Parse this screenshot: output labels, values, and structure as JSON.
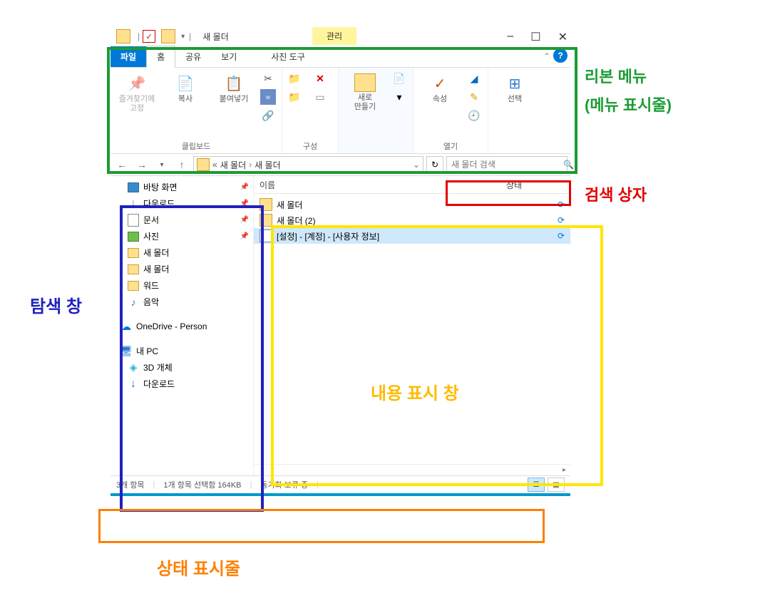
{
  "titlebar": {
    "title": "새 몰더",
    "contextual_tab": "관리"
  },
  "window_buttons": {
    "min": "–",
    "max": "☐",
    "close": "✕"
  },
  "tabs": {
    "file": "파일",
    "home": "홈",
    "share": "공유",
    "view": "보기",
    "tools": "사진 도구"
  },
  "ribbon": {
    "group1": {
      "pin": "즐겨찾기에\n고정",
      "copy": "복사",
      "paste": "붙여넣기",
      "label": "클립보드"
    },
    "group2": {
      "label": "구성"
    },
    "group3": {
      "new": "새로\n만들기",
      "label": ""
    },
    "group4": {
      "props": "속성",
      "label": "열기"
    },
    "group5": {
      "select": "선택"
    }
  },
  "nav_buttons": {
    "back": "←",
    "fwd": "→",
    "recent": "▾",
    "up": "↑"
  },
  "address": {
    "chevron": "«",
    "part1": "새 몰더",
    "part2": "새 몰더",
    "sep": "›"
  },
  "search": {
    "placeholder": "새 몰더 검색"
  },
  "columns": {
    "name": "이름",
    "status": "상태"
  },
  "navpane": [
    {
      "icon": "desktop",
      "label": "바탕 화면",
      "pinned": true
    },
    {
      "icon": "download",
      "label": "다운로드",
      "pinned": true
    },
    {
      "icon": "doc",
      "label": "문서",
      "pinned": true
    },
    {
      "icon": "pic",
      "label": "사진",
      "pinned": true
    },
    {
      "icon": "folder",
      "label": "새 몰더",
      "pinned": false
    },
    {
      "icon": "folder",
      "label": "새 몰더",
      "pinned": false
    },
    {
      "icon": "folder",
      "label": "워드",
      "pinned": false
    },
    {
      "icon": "music",
      "label": "음악",
      "pinned": false
    },
    {
      "icon": "cloud",
      "label": "OneDrive - Person",
      "pinned": false
    },
    {
      "icon": "pc",
      "label": "내 PC",
      "pinned": false
    },
    {
      "icon": "3d",
      "label": "3D 개체",
      "pinned": false
    },
    {
      "icon": "download",
      "label": "다운로드",
      "pinned": false
    }
  ],
  "rows": [
    {
      "type": "folder",
      "name": "새 몰더",
      "sync": true,
      "selected": false
    },
    {
      "type": "folder",
      "name": "새 몰더 (2)",
      "sync": true,
      "selected": false
    },
    {
      "type": "file",
      "name": "[설정] - [계정] - [사용자 정보]",
      "sync": true,
      "selected": true
    }
  ],
  "status": {
    "count": "3개 항목",
    "selected": "1개 항목 선택함 164KB",
    "sync": "동기화 보류 중"
  },
  "annotations": {
    "ribbon1": "리본 메뉴",
    "ribbon2": "(메뉴 표시줄)",
    "search": "검색 상자",
    "nav": "탐색 창",
    "content": "내용 표시 창",
    "status": "상태 표시줄"
  }
}
